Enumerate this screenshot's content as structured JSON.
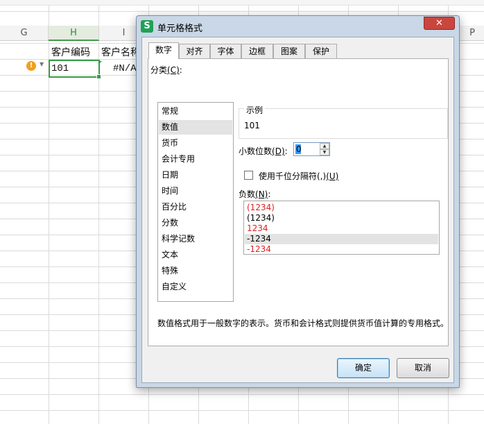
{
  "sheet": {
    "columns": [
      "G",
      "H",
      "I",
      "P"
    ],
    "active_column": "H",
    "header_row": {
      "h": "客户编码",
      "i": "客户名称"
    },
    "data_row": {
      "h": "101",
      "i": "#N/A"
    },
    "warning_icon": "exclamation-icon"
  },
  "dialog": {
    "title": "单元格格式",
    "app_icon_letter": "S",
    "close_glyph": "✕",
    "tabs": [
      "数字",
      "对齐",
      "字体",
      "边框",
      "图案",
      "保护"
    ],
    "active_tab": "数字",
    "category_label": "分类",
    "category_hotkey": "(C)",
    "categories": [
      "常规",
      "数值",
      "货币",
      "会计专用",
      "日期",
      "时间",
      "百分比",
      "分数",
      "科学记数",
      "文本",
      "特殊",
      "自定义"
    ],
    "selected_category": "数值",
    "sample_label": "示例",
    "sample_value": "101",
    "decimal_label": "小数位数",
    "decimal_hotkey": "(D)",
    "decimal_value": "0",
    "thousands_label": "使用千位分隔符(,)",
    "thousands_hotkey": "(U)",
    "thousands_checked": false,
    "negative_label": "负数",
    "negative_hotkey": "(N)",
    "negative_options": [
      {
        "text": "(1234)",
        "color": "#e02020"
      },
      {
        "text": "(1234)",
        "color": "#000000"
      },
      {
        "text": "1234",
        "color": "#e02020"
      },
      {
        "text": "-1234",
        "color": "#000000"
      },
      {
        "text": "-1234",
        "color": "#e02020"
      }
    ],
    "selected_negative_index": 3,
    "description": "数值格式用于一般数字的表示。货币和会计格式则提供货币值计算的专用格式。",
    "ok_label": "确定",
    "cancel_label": "取消"
  },
  "colors": {
    "accent_green": "#3a9a47",
    "negative_red": "#e02020",
    "close_red": "#c9463d"
  }
}
